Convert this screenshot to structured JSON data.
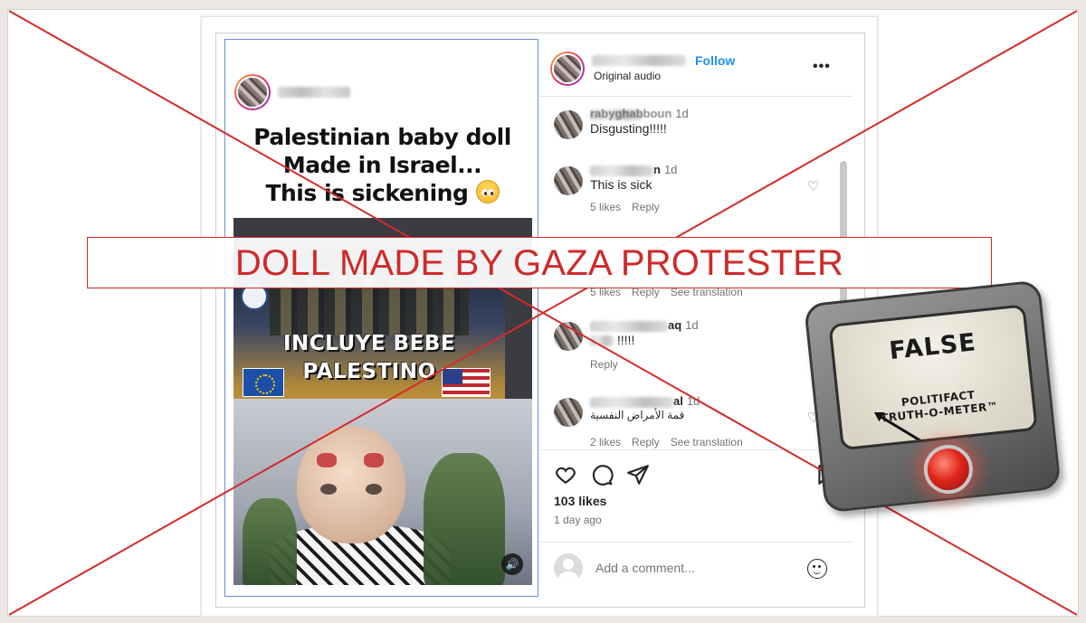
{
  "post": {
    "media": {
      "headline_lines": [
        "Palestinian baby doll",
        "Made in Israel...",
        "This is sickening"
      ],
      "photo_text_lines": [
        "INCLUYE BEBE",
        "PALESTINO"
      ]
    },
    "header": {
      "follow_label": "Follow",
      "audio_label": "Original audio",
      "more_label": "•••"
    },
    "comments": [
      {
        "user": "rabyghabboun",
        "time": "1d",
        "text": "Disgusting!!!!!",
        "likes": "",
        "reply": "",
        "translate": ""
      },
      {
        "user": "n",
        "time": "1d",
        "text": "This is sick",
        "likes": "5 likes",
        "reply": "Reply",
        "translate": ""
      },
      {
        "user": "",
        "time": "",
        "text": "",
        "likes": "5 likes",
        "reply": "Reply",
        "translate": "See translation"
      },
      {
        "user": "aq",
        "time": "1d",
        "text": "!!!!!",
        "likes": "",
        "reply": "Reply",
        "translate": ""
      },
      {
        "user": "al",
        "time": "1d",
        "text": "قمة الأمراض النفسية",
        "likes": "2 likes",
        "reply": "Reply",
        "translate": "See translation"
      }
    ],
    "likes_count": "103 likes",
    "posted_ago": "1 day ago",
    "add_comment_placeholder": "Add a comment..."
  },
  "overlay": {
    "banner_text": "DOLL MADE BY GAZA PROTESTER",
    "cross_color": "#d42a2a"
  },
  "meter": {
    "rating": "FALSE",
    "brand_line1": "POLITIFACT",
    "brand_line2": "TRUTH-O-METER™"
  },
  "icons": {
    "heart": "heart-icon",
    "comment": "comment-icon",
    "share": "share-icon",
    "bookmark": "bookmark-icon",
    "emoji": "emoji-icon",
    "sound": "speaker-icon"
  }
}
